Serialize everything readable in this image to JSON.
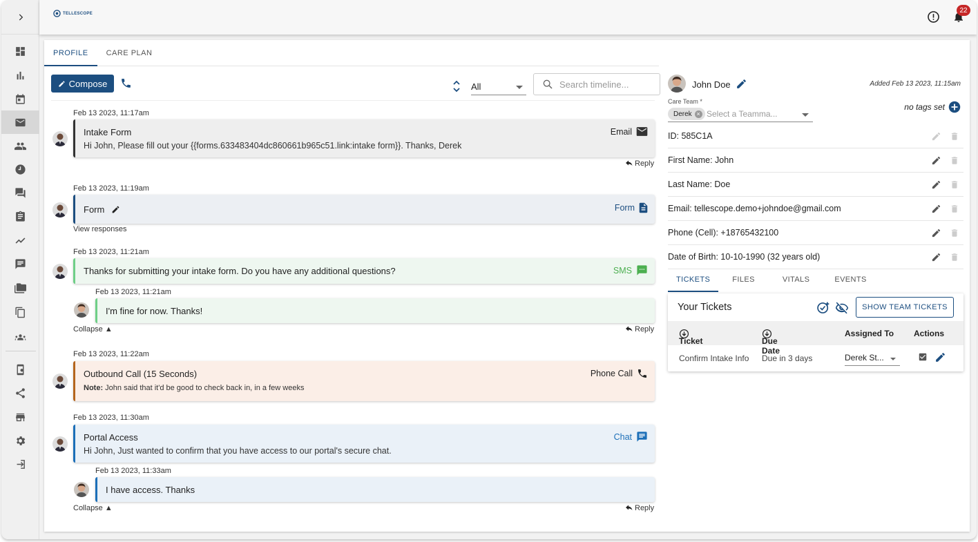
{
  "app": {
    "logo_text": "TELLESCOPE",
    "notification_count": "22"
  },
  "nav_tabs": [
    "PROFILE",
    "CARE PLAN"
  ],
  "toolbar": {
    "compose_label": "Compose",
    "filter_value": "All",
    "search_placeholder": "Search timeline..."
  },
  "timeline": [
    {
      "timestamp": "Feb 13 2023, 11:17am",
      "title": "Intake Form",
      "body": "Hi John, Please fill out your {{forms.633483404dc860661b965c51.link:intake form}}. Thanks, Derek",
      "kind": "Email",
      "footer_right": "Reply"
    },
    {
      "timestamp": "Feb 13 2023, 11:19am",
      "title": "Form",
      "kind": "Form",
      "footer_left": "View responses"
    },
    {
      "timestamp": "Feb 13 2023, 11:21am",
      "title": "Thanks for submitting your intake form. Do you have any additional questions?",
      "kind": "SMS",
      "reply": {
        "timestamp": "Feb 13 2023, 11:21am",
        "title": "I'm fine for now. Thanks!"
      },
      "footer_left": "Collapse ▲",
      "footer_right": "Reply"
    },
    {
      "timestamp": "Feb 13 2023, 11:22am",
      "title": "Outbound Call (15 Seconds)",
      "note_label": "Note:",
      "note": "John said that it'd be good to check back in, in a few weeks",
      "kind": "Phone Call"
    },
    {
      "timestamp": "Feb 13 2023, 11:30am",
      "title": "Portal Access",
      "body": "Hi John, Just wanted to confirm that you have access to our portal's secure chat.",
      "kind": "Chat",
      "reply": {
        "timestamp": "Feb 13 2023, 11:33am",
        "title": "I have access. Thanks"
      },
      "footer_left": "Collapse ▲",
      "footer_right": "Reply"
    }
  ],
  "patient": {
    "name": "John Doe",
    "added": "Added Feb 13 2023, 11:15am",
    "care_team_label": "Care Team *",
    "care_team_chip": "Derek",
    "care_team_placeholder": "Select a Teamma...",
    "tags_text": "no tags set",
    "fields": [
      "ID: 585C1A",
      "First Name: John",
      "Last Name: Doe",
      "Email: tellescope.demo+johndoe@gmail.com",
      "Phone (Cell): +18765432100",
      "Date of Birth: 10-10-1990 (32 years old)"
    ]
  },
  "right_tabs": [
    "TICKETS",
    "FILES",
    "VITALS",
    "EVENTS"
  ],
  "tickets": {
    "title": "Your Tickets",
    "button": "SHOW TEAM TICKETS",
    "columns": [
      "Ticket",
      "Due Date",
      "Assigned To",
      "Actions"
    ],
    "rows": [
      {
        "ticket": "Confirm Intake Info",
        "due": "Due in 3 days",
        "assigned": "Derek St..."
      }
    ]
  },
  "colors": {
    "primary": "#1c4e80",
    "email_bar": "#333333",
    "form_bar": "#1c4e80",
    "sms_bar": "#6fcf87",
    "call_bar": "#b5651d",
    "chat_bar": "#1c6fb8"
  }
}
